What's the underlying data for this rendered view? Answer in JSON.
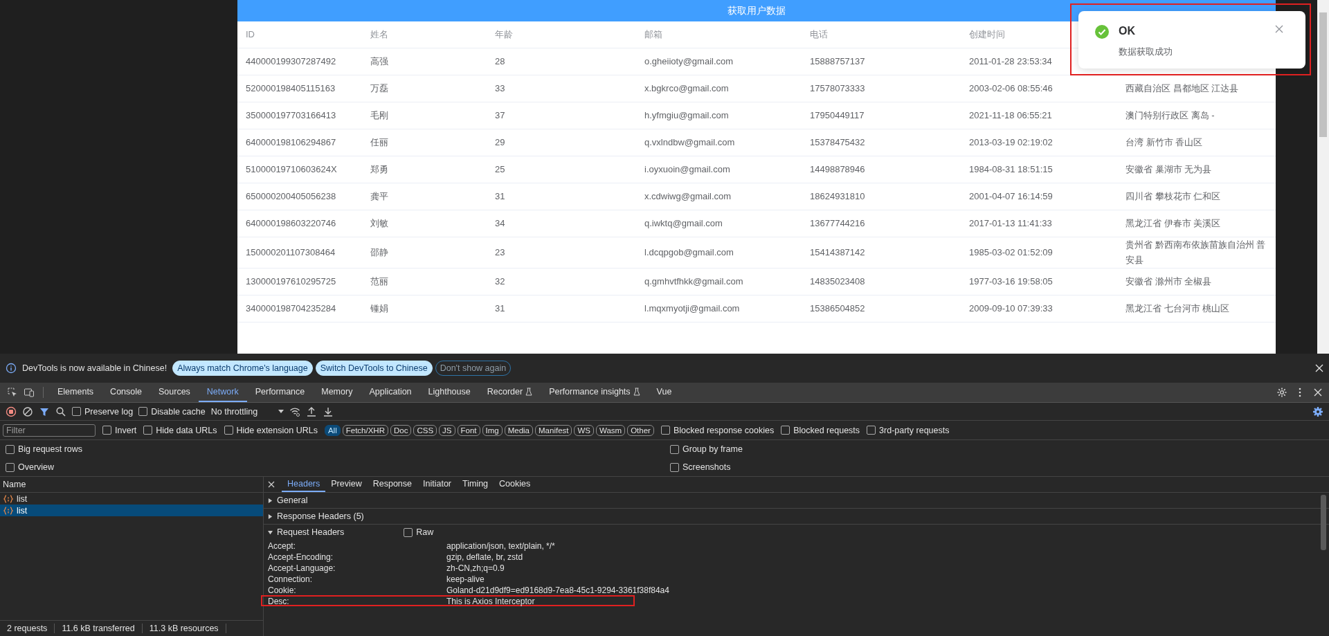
{
  "fetch_button": {
    "label": "获取用户数据"
  },
  "table": {
    "columns": [
      "ID",
      "姓名",
      "年龄",
      "邮箱",
      "电话",
      "创建时间"
    ],
    "rows": [
      {
        "id": "440000199307287492",
        "name": "高强",
        "age": "28",
        "email": "o.gheiioty@gmail.com",
        "phone": "15888757137",
        "created": "2011-01-28 23:53:34"
      },
      {
        "id": "520000198405115163",
        "name": "万磊",
        "age": "33",
        "email": "x.bgkrco@gmail.com",
        "phone": "17578073333",
        "created": "2003-02-06 08:55:46",
        "address": "西藏自治区 昌都地区 江达县"
      },
      {
        "id": "350000197703166413",
        "name": "毛刚",
        "age": "37",
        "email": "h.yfmgiu@gmail.com",
        "phone": "17950449117",
        "created": "2021-11-18 06:55:21",
        "address": "澳门特别行政区 离岛 -"
      },
      {
        "id": "640000198106294867",
        "name": "任丽",
        "age": "29",
        "email": "q.vxlndbw@gmail.com",
        "phone": "15378475432",
        "created": "2013-03-19 02:19:02",
        "address": "台湾 新竹市 香山区"
      },
      {
        "id": "51000019710603624X",
        "name": "郑勇",
        "age": "25",
        "email": "i.oyxuoin@gmail.com",
        "phone": "14498878946",
        "created": "1984-08-31 18:51:15",
        "address": "安徽省 巢湖市 无为县"
      },
      {
        "id": "650000200405056238",
        "name": "龚平",
        "age": "31",
        "email": "x.cdwiwg@gmail.com",
        "phone": "18624931810",
        "created": "2001-04-07 16:14:59",
        "address": "四川省 攀枝花市 仁和区"
      },
      {
        "id": "640000198603220746",
        "name": "刘敏",
        "age": "34",
        "email": "q.iwktq@gmail.com",
        "phone": "13677744216",
        "created": "2017-01-13 11:41:33",
        "address": "黑龙江省 伊春市 美溪区"
      },
      {
        "id": "150000201107308464",
        "name": "邵静",
        "age": "23",
        "email": "l.dcqpgob@gmail.com",
        "phone": "15414387142",
        "created": "1985-03-02 01:52:09",
        "address": "贵州省 黔西南布依族苗族自治州 普安县"
      },
      {
        "id": "130000197610295725",
        "name": "范丽",
        "age": "32",
        "email": "q.gmhvtfhkk@gmail.com",
        "phone": "14835023408",
        "created": "1977-03-16 19:58:05",
        "address": "安徽省 滁州市 全椒县"
      },
      {
        "id": "340000198704235284",
        "name": "锺娟",
        "age": "31",
        "email": "l.mqxmyotji@gmail.com",
        "phone": "15386504852",
        "created": "2009-09-10 07:39:33",
        "address": "黑龙江省 七台河市 桃山区"
      }
    ]
  },
  "toast": {
    "kind": "success",
    "title": "OK",
    "message": "数据获取成功",
    "highlighted": true
  },
  "devtools": {
    "infobar": {
      "message": "DevTools is now available in Chinese!",
      "buttons": [
        {
          "label": "Always match Chrome's language",
          "kind": "filled"
        },
        {
          "label": "Switch DevTools to Chinese",
          "kind": "filled"
        },
        {
          "label": "Don't show again",
          "kind": "outline"
        }
      ]
    },
    "tabs": [
      {
        "label": "Elements",
        "selected": false,
        "experimental": false
      },
      {
        "label": "Console",
        "selected": false,
        "experimental": false
      },
      {
        "label": "Sources",
        "selected": false,
        "experimental": false
      },
      {
        "label": "Network",
        "selected": true,
        "experimental": false
      },
      {
        "label": "Performance",
        "selected": false,
        "experimental": false
      },
      {
        "label": "Memory",
        "selected": false,
        "experimental": false
      },
      {
        "label": "Application",
        "selected": false,
        "experimental": false
      },
      {
        "label": "Lighthouse",
        "selected": false,
        "experimental": false
      },
      {
        "label": "Recorder",
        "selected": false,
        "experimental": true
      },
      {
        "label": "Performance insights",
        "selected": false,
        "experimental": true
      },
      {
        "label": "Vue",
        "selected": false,
        "experimental": false
      }
    ],
    "toolbar": {
      "checkboxes": [
        {
          "label": "Preserve log",
          "checked": false
        },
        {
          "label": "Disable cache",
          "checked": false
        }
      ],
      "throttling": "No throttling"
    },
    "filter": {
      "placeholder": "Filter",
      "checkboxes": [
        {
          "label": "Invert",
          "checked": false
        },
        {
          "label": "Hide data URLs",
          "checked": false
        },
        {
          "label": "Hide extension URLs",
          "checked": false
        }
      ],
      "types": [
        {
          "label": "All",
          "selected": true
        },
        {
          "label": "Fetch/XHR",
          "selected": false
        },
        {
          "label": "Doc",
          "selected": false
        },
        {
          "label": "CSS",
          "selected": false
        },
        {
          "label": "JS",
          "selected": false
        },
        {
          "label": "Font",
          "selected": false
        },
        {
          "label": "Img",
          "selected": false
        },
        {
          "label": "Media",
          "selected": false
        },
        {
          "label": "Manifest",
          "selected": false
        },
        {
          "label": "WS",
          "selected": false
        },
        {
          "label": "Wasm",
          "selected": false
        },
        {
          "label": "Other",
          "selected": false
        }
      ],
      "more_checkboxes": [
        {
          "label": "Blocked response cookies",
          "checked": false
        },
        {
          "label": "Blocked requests",
          "checked": false
        },
        {
          "label": "3rd-party requests",
          "checked": false
        }
      ]
    },
    "options": [
      {
        "label": "Big request rows",
        "checked": false
      },
      {
        "label": "Group by frame",
        "checked": false
      },
      {
        "label": "Overview",
        "checked": false
      },
      {
        "label": "Screenshots",
        "checked": false
      }
    ],
    "requests": {
      "heading": "Name",
      "items": [
        {
          "name": "list",
          "selected": false
        },
        {
          "name": "list",
          "selected": true
        }
      ]
    },
    "detail_tabs": [
      {
        "label": "Headers",
        "selected": true
      },
      {
        "label": "Preview",
        "selected": false
      },
      {
        "label": "Response",
        "selected": false
      },
      {
        "label": "Initiator",
        "selected": false
      },
      {
        "label": "Timing",
        "selected": false
      },
      {
        "label": "Cookies",
        "selected": false
      }
    ],
    "sections": [
      {
        "title": "General",
        "expanded": false
      },
      {
        "title": "Response Headers (5)",
        "expanded": false
      },
      {
        "title": "Request Headers",
        "expanded": true,
        "raw": {
          "label": "Raw",
          "checked": false
        },
        "headers": [
          {
            "name": "Accept:",
            "value": "application/json, text/plain, */*",
            "highlighted": false
          },
          {
            "name": "Accept-Encoding:",
            "value": "gzip, deflate, br, zstd",
            "highlighted": false
          },
          {
            "name": "Accept-Language:",
            "value": "zh-CN,zh;q=0.9",
            "highlighted": false
          },
          {
            "name": "Connection:",
            "value": "keep-alive",
            "highlighted": false
          },
          {
            "name": "Cookie:",
            "value": "Goland-d21d9df9=ed9168d9-7ea8-45c1-9294-3361f38f84a4",
            "highlighted": false
          },
          {
            "name": "Desc:",
            "value": "This is Axios Interceptor",
            "highlighted": true
          }
        ]
      }
    ],
    "status": [
      "2 requests",
      "11.6 kB transferred",
      "11.3 kB resources"
    ]
  }
}
